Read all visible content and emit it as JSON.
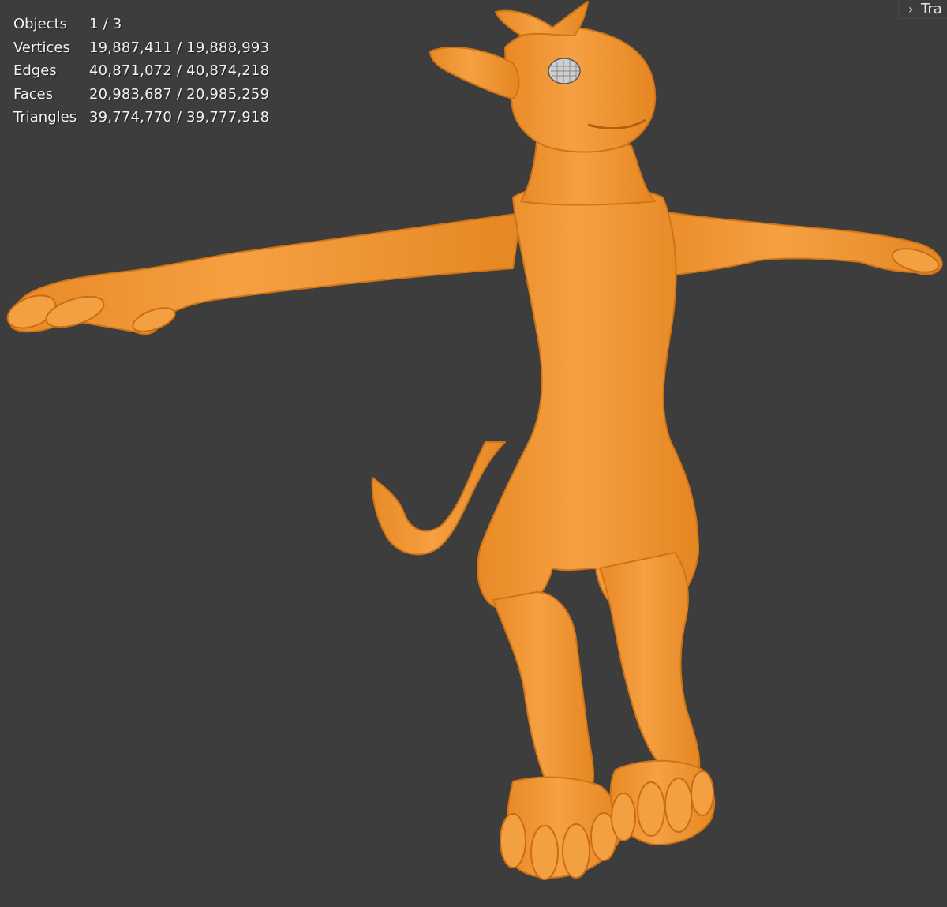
{
  "viewport": {
    "background_color": "#3d3d3d",
    "model_color": "#f29833",
    "model_edge_color": "#d97a1d"
  },
  "stats": [
    {
      "label": "Objects",
      "value": "1 / 3"
    },
    {
      "label": "Vertices",
      "value": "19,887,411 / 19,888,993"
    },
    {
      "label": "Edges",
      "value": "40,871,072 / 40,874,218"
    },
    {
      "label": "Faces",
      "value": "20,983,687 / 20,985,259"
    },
    {
      "label": "Triangles",
      "value": "39,774,770 / 39,777,918"
    }
  ],
  "sidebar_tab": {
    "icon": "chevron-right-icon",
    "label": "Tra"
  }
}
